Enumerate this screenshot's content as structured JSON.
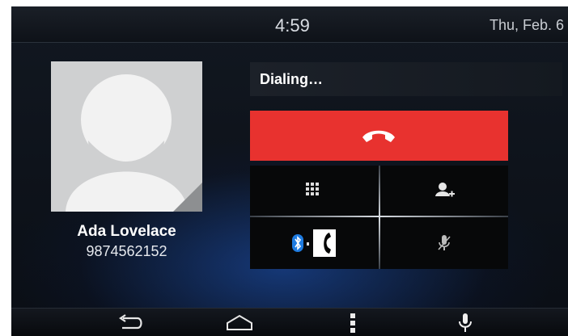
{
  "status_bar": {
    "time": "4:59",
    "date": "Thu, Feb. 6"
  },
  "contact": {
    "name": "Ada Lovelace",
    "number": "9874562152"
  },
  "call": {
    "status": "Dialing…"
  },
  "colors": {
    "end_call": "#e8322f",
    "accent_glow": "#1e5ac8"
  },
  "controls": {
    "end_call": "end-call-icon",
    "keypad": "keypad-icon",
    "add_caller": "add-person-icon",
    "audio_source": "bluetooth-phone-icon",
    "mute": "microphone-mute-icon"
  },
  "nav": {
    "back": "back-icon",
    "home": "home-icon",
    "menu": "menu-dots-icon",
    "voice": "microphone-icon"
  }
}
